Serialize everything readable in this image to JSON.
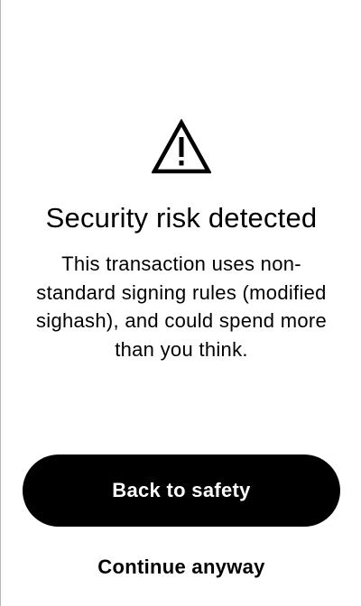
{
  "alert": {
    "icon": "warning-triangle-icon",
    "title": "Security risk detected",
    "message": "This transaction uses non-standard signing rules (modified sighash), and could spend more than you think."
  },
  "actions": {
    "primary_label": "Back to safety",
    "secondary_label": "Continue anyway"
  },
  "colors": {
    "background": "#ffffff",
    "text": "#000000",
    "button_background": "#000000",
    "button_text": "#ffffff"
  }
}
